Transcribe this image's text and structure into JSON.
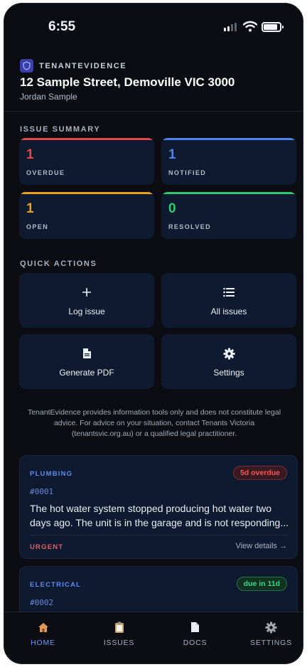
{
  "status_bar": {
    "time": "6:55"
  },
  "header": {
    "brand": "TENANTEVIDENCE",
    "address": "12 Sample Street, Demoville VIC 3000",
    "tenant": "Jordan Sample"
  },
  "summary": {
    "label": "ISSUE SUMMARY",
    "cards": [
      {
        "count": "1",
        "label": "OVERDUE",
        "color": "#e54848"
      },
      {
        "count": "1",
        "label": "NOTIFIED",
        "color": "#4c83f0"
      },
      {
        "count": "1",
        "label": "OPEN",
        "color": "#f0a21f"
      },
      {
        "count": "0",
        "label": "RESOLVED",
        "color": "#2ecc71"
      }
    ]
  },
  "quick_actions": {
    "label": "QUICK ACTIONS",
    "items": [
      {
        "label": "Log issue",
        "icon": "plus-icon"
      },
      {
        "label": "All issues",
        "icon": "list-icon"
      },
      {
        "label": "Generate PDF",
        "icon": "document-icon"
      },
      {
        "label": "Settings",
        "icon": "gear-icon"
      }
    ]
  },
  "disclaimer": "TenantEvidence provides information tools only and does not constitute legal advice. For advice on your situation, contact Tenants Victoria (tenantsvic.org.au) or a qualified legal practitioner.",
  "issues": [
    {
      "category": "PLUMBING",
      "status": "5d overdue",
      "ref": "#0001",
      "description": "The hot water system stopped producing hot water two days ago. The unit is in the garage and is not responding...",
      "priority": "URGENT",
      "link": "View details →"
    },
    {
      "category": "ELECTRICAL",
      "status": "due in 11d",
      "ref": "#0002"
    }
  ],
  "tabs": [
    {
      "label": "HOME",
      "icon": "home-icon",
      "active": true
    },
    {
      "label": "ISSUES",
      "icon": "clipboard-icon",
      "active": false
    },
    {
      "label": "DOCS",
      "icon": "file-icon",
      "active": false
    },
    {
      "label": "SETTINGS",
      "icon": "gear-icon",
      "active": false
    }
  ]
}
